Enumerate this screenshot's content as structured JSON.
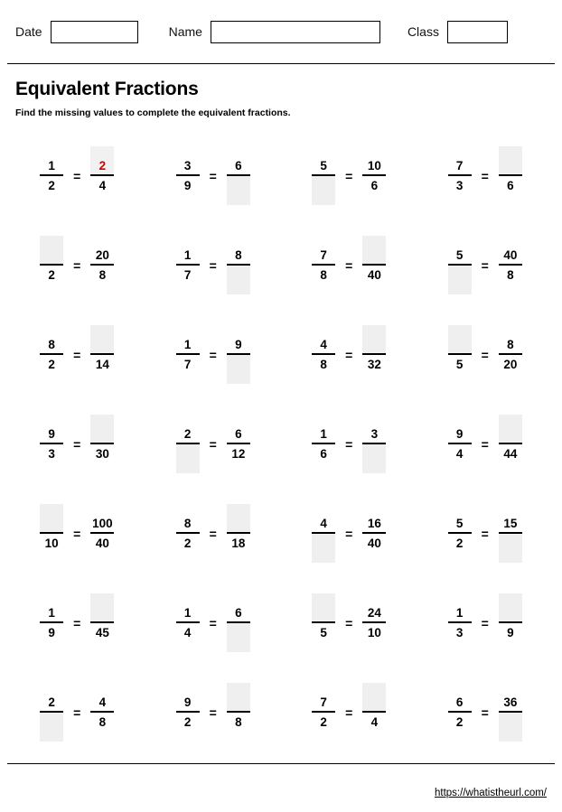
{
  "header": {
    "date_label": "Date",
    "date_value": "",
    "name_label": "Name",
    "name_value": "",
    "class_label": "Class",
    "class_value": ""
  },
  "title": "Equivalent Fractions",
  "subtitle": "Find the missing values to complete the equivalent fractions.",
  "equals_sign": "=",
  "colors": {
    "answer_text": "#cc0000",
    "blank_fill": "#efefef",
    "rule": "#000000"
  },
  "footer": {
    "url": "https://whatistheurl.com/"
  },
  "problems": [
    [
      {
        "left": {
          "num": "1",
          "den": "2"
        },
        "right": {
          "num": "2",
          "den": "4"
        },
        "blank": "right.num",
        "answered": true
      },
      {
        "left": {
          "num": "3",
          "den": "9"
        },
        "right": {
          "num": "6",
          "den": ""
        },
        "blank": "right.den",
        "answered": false
      },
      {
        "left": {
          "num": "5",
          "den": ""
        },
        "right": {
          "num": "10",
          "den": "6"
        },
        "blank": "left.den",
        "answered": false
      },
      {
        "left": {
          "num": "7",
          "den": "3"
        },
        "right": {
          "num": "",
          "den": "6"
        },
        "blank": "right.num",
        "answered": false
      }
    ],
    [
      {
        "left": {
          "num": "",
          "den": "2"
        },
        "right": {
          "num": "20",
          "den": "8"
        },
        "blank": "left.num",
        "answered": false
      },
      {
        "left": {
          "num": "1",
          "den": "7"
        },
        "right": {
          "num": "8",
          "den": ""
        },
        "blank": "right.den",
        "answered": false
      },
      {
        "left": {
          "num": "7",
          "den": "8"
        },
        "right": {
          "num": "",
          "den": "40"
        },
        "blank": "right.num",
        "answered": false
      },
      {
        "left": {
          "num": "5",
          "den": ""
        },
        "right": {
          "num": "40",
          "den": "8"
        },
        "blank": "left.den",
        "answered": false
      }
    ],
    [
      {
        "left": {
          "num": "8",
          "den": "2"
        },
        "right": {
          "num": "",
          "den": "14"
        },
        "blank": "right.num",
        "answered": false
      },
      {
        "left": {
          "num": "1",
          "den": "7"
        },
        "right": {
          "num": "9",
          "den": ""
        },
        "blank": "right.den",
        "answered": false
      },
      {
        "left": {
          "num": "4",
          "den": "8"
        },
        "right": {
          "num": "",
          "den": "32"
        },
        "blank": "right.num",
        "answered": false
      },
      {
        "left": {
          "num": "",
          "den": "5"
        },
        "right": {
          "num": "8",
          "den": "20"
        },
        "blank": "left.num",
        "answered": false
      }
    ],
    [
      {
        "left": {
          "num": "9",
          "den": "3"
        },
        "right": {
          "num": "",
          "den": "30"
        },
        "blank": "right.num",
        "answered": false
      },
      {
        "left": {
          "num": "2",
          "den": ""
        },
        "right": {
          "num": "6",
          "den": "12"
        },
        "blank": "left.den",
        "answered": false
      },
      {
        "left": {
          "num": "1",
          "den": "6"
        },
        "right": {
          "num": "3",
          "den": ""
        },
        "blank": "right.den",
        "answered": false
      },
      {
        "left": {
          "num": "9",
          "den": "4"
        },
        "right": {
          "num": "",
          "den": "44"
        },
        "blank": "right.num",
        "answered": false
      }
    ],
    [
      {
        "left": {
          "num": "",
          "den": "10"
        },
        "right": {
          "num": "100",
          "den": "40"
        },
        "blank": "left.num",
        "answered": false
      },
      {
        "left": {
          "num": "8",
          "den": "2"
        },
        "right": {
          "num": "",
          "den": "18"
        },
        "blank": "right.num",
        "answered": false
      },
      {
        "left": {
          "num": "4",
          "den": ""
        },
        "right": {
          "num": "16",
          "den": "40"
        },
        "blank": "left.den",
        "answered": false
      },
      {
        "left": {
          "num": "5",
          "den": "2"
        },
        "right": {
          "num": "15",
          "den": ""
        },
        "blank": "right.den",
        "answered": false
      }
    ],
    [
      {
        "left": {
          "num": "1",
          "den": "9"
        },
        "right": {
          "num": "",
          "den": "45"
        },
        "blank": "right.num",
        "answered": false
      },
      {
        "left": {
          "num": "1",
          "den": "4"
        },
        "right": {
          "num": "6",
          "den": ""
        },
        "blank": "right.den",
        "answered": false
      },
      {
        "left": {
          "num": "",
          "den": "5"
        },
        "right": {
          "num": "24",
          "den": "10"
        },
        "blank": "left.num",
        "answered": false
      },
      {
        "left": {
          "num": "1",
          "den": "3"
        },
        "right": {
          "num": "",
          "den": "9"
        },
        "blank": "right.num",
        "answered": false
      }
    ],
    [
      {
        "left": {
          "num": "2",
          "den": ""
        },
        "right": {
          "num": "4",
          "den": "8"
        },
        "blank": "left.den",
        "answered": false
      },
      {
        "left": {
          "num": "9",
          "den": "2"
        },
        "right": {
          "num": "",
          "den": "8"
        },
        "blank": "right.num",
        "answered": false
      },
      {
        "left": {
          "num": "7",
          "den": "2"
        },
        "right": {
          "num": "",
          "den": "4"
        },
        "blank": "right.num",
        "answered": false
      },
      {
        "left": {
          "num": "6",
          "den": "2"
        },
        "right": {
          "num": "36",
          "den": ""
        },
        "blank": "right.den",
        "answered": false
      }
    ]
  ]
}
